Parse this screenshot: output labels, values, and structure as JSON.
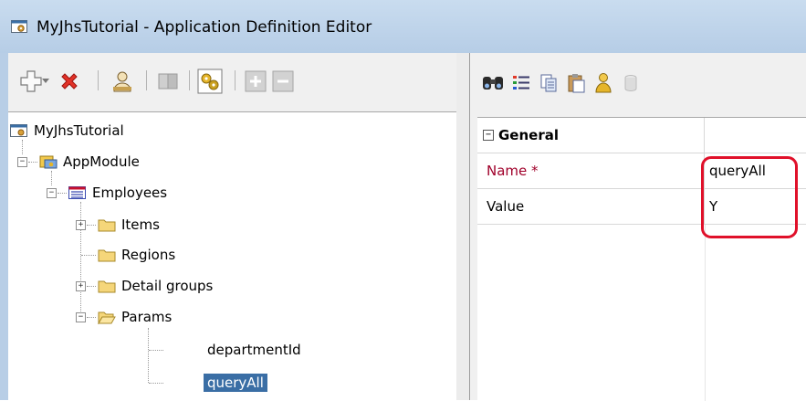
{
  "window": {
    "title": "MyJhsTutorial - Application Definition Editor"
  },
  "left_toolbar": {
    "icons": [
      "add-icon",
      "chevron-down-icon",
      "delete-icon",
      "user-icon",
      "copy-disabled-icon",
      "generate-icon",
      "expand-all-icon",
      "collapse-all-icon"
    ]
  },
  "right_toolbar": {
    "icons": [
      "find-icon",
      "list-view-icon",
      "copy-icon",
      "paste-icon",
      "user-icon",
      "database-icon"
    ]
  },
  "tree": {
    "root": "MyJhsTutorial",
    "app_module": "AppModule",
    "group": "Employees",
    "items": "Items",
    "regions": "Regions",
    "detail_groups": "Detail groups",
    "params": "Params",
    "param_1": "departmentId",
    "param_2": "queryAll"
  },
  "properties": {
    "section": "General",
    "rows": [
      {
        "key": "Name *",
        "value": "queryAll",
        "key_color": "#a0002a"
      },
      {
        "key": "Value",
        "value": "Y",
        "key_color": "#000000"
      }
    ]
  },
  "colors": {
    "selection": "#3a6ea5",
    "highlight": "#e0102a",
    "titlebar": "#c3d6ec"
  }
}
